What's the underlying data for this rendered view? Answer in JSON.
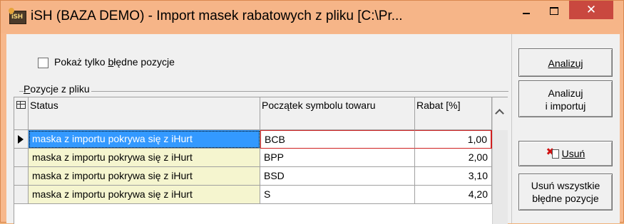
{
  "window": {
    "app_badge": "iSH",
    "title": "iSH (BAZA DEMO) - Import masek rabatowych z pliku [C:\\Pr...",
    "minimize_label": "–",
    "maximize_label": "□",
    "close_label": "✕"
  },
  "filter": {
    "checkbox_label": "Pokaż tylko błędne pozycje",
    "checked": false
  },
  "group": {
    "title": "Pozycje z pliku"
  },
  "table": {
    "columns": [
      "Status",
      "Początek symbolu towaru",
      "Rabat [%]"
    ],
    "rows": [
      {
        "status": "maska z importu pokrywa się z iHurt",
        "prefix": "BCB",
        "rabat": "1,00",
        "selected": true
      },
      {
        "status": "maska z importu pokrywa się z iHurt",
        "prefix": "BPP",
        "rabat": "2,00",
        "selected": false
      },
      {
        "status": "maska z importu pokrywa się z iHurt",
        "prefix": "BSD",
        "rabat": "3,10",
        "selected": false
      },
      {
        "status": "maska z importu pokrywa się z iHurt",
        "prefix": "S",
        "rabat": "4,20",
        "selected": false
      }
    ]
  },
  "buttons": {
    "analyze": "Analizuj",
    "analyze_import_line1": "Analizuj",
    "analyze_import_line2": "i importuj",
    "delete": "Usuń",
    "delete_all_line1": "Usuń wszystkie",
    "delete_all_line2": "błędne pozycje"
  },
  "colors": {
    "titlebar": "#f6b588",
    "close_button": "#c9483f",
    "status_cell": "#f5f5cf",
    "selection": "#3399ff",
    "focus_border": "#d02020"
  }
}
